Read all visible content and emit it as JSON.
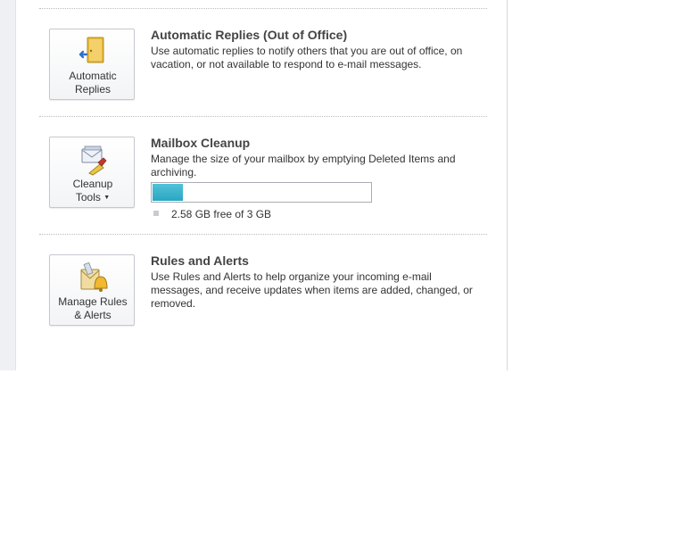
{
  "sections": [
    {
      "button_label_line1": "Automatic",
      "button_label_line2": "Replies",
      "icon": "automatic-replies-icon",
      "title": "Automatic Replies (Out of Office)",
      "description": "Use automatic replies to notify others that you are out of office, on vacation, or not available to respond to e-mail messages."
    },
    {
      "button_label_line1": "Cleanup",
      "button_label_line2": "Tools",
      "icon": "cleanup-tools-icon",
      "title": "Mailbox Cleanup",
      "description": "Manage the size of your mailbox by emptying Deleted Items and archiving.",
      "quota": {
        "used_fraction": 0.14,
        "text": "2.58 GB free of 3 GB",
        "fill_color": "#2aa6c2"
      }
    },
    {
      "button_label_line1": "Manage Rules",
      "button_label_line2": "& Alerts",
      "icon": "rules-alerts-icon",
      "title": "Rules and Alerts",
      "description": "Use Rules and Alerts to help organize your incoming e-mail messages, and receive updates when items are added, changed, or removed."
    }
  ]
}
